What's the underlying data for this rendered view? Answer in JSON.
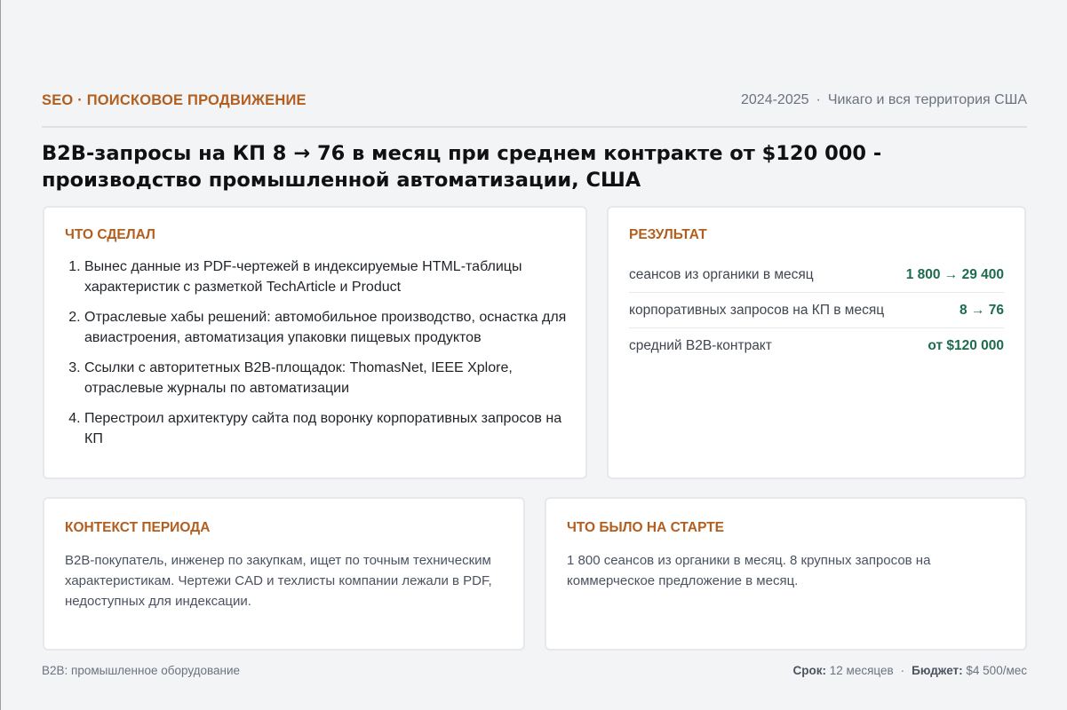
{
  "header": {
    "tag": "SEO · ПОИСКОВОЕ ПРОДВИЖЕНИЕ",
    "period": "2024-2025",
    "location": "Чикаго и вся территория США"
  },
  "title": "B2B-запросы на КП 8 → 76 в месяц при среднем контракте от $120 000 - производство промышленной автоматизации, США",
  "done": {
    "title": "ЧТО СДЕЛАЛ",
    "steps": [
      "Вынес данные из PDF-чертежей в индексируемые HTML-таблицы характеристик с разметкой TechArticle и Product",
      "Отраслевые хабы решений: автомобильное производство, оснастка для авиастроения, автоматизация упаковки пищевых продуктов",
      "Ссылки с авторитетных B2B-площадок: ThomasNet, IEEE Xplore, отраслевые журналы по автоматизации",
      "Перестроил архитектуру сайта под воронку корпоративных запросов на КП"
    ]
  },
  "result": {
    "title": "РЕЗУЛЬТАТ",
    "rows": [
      {
        "label": "сеансов из органики в месяц",
        "value": "1 800 → 29 400"
      },
      {
        "label": "корпоративных запросов на КП в месяц",
        "value": "8 → 76"
      },
      {
        "label": "средний B2B-контракт",
        "value": "от $120 000"
      }
    ]
  },
  "context": {
    "title": "КОНТЕКСТ ПЕРИОДА",
    "text": "B2B-покупатель, инженер по закупкам, ищет по точным техническим характеристикам. Чертежи CAD и техлисты компании лежали в PDF, недоступных для индексации."
  },
  "start": {
    "title": "ЧТО БЫЛО НА СТАРТЕ",
    "text": "1 800 сеансов из органики в месяц. 8 крупных запросов на коммерческое предложение в месяц."
  },
  "footer": {
    "industry": "B2B: промышленное оборудование",
    "term_label": "Срок:",
    "term_value": "12 месяцев",
    "budget_label": "Бюджет:",
    "budget_value": "$4 500/мес"
  },
  "colors": {
    "accent": "#b25e1f",
    "value": "#1e6b4e",
    "background": "#f3f4f6"
  }
}
